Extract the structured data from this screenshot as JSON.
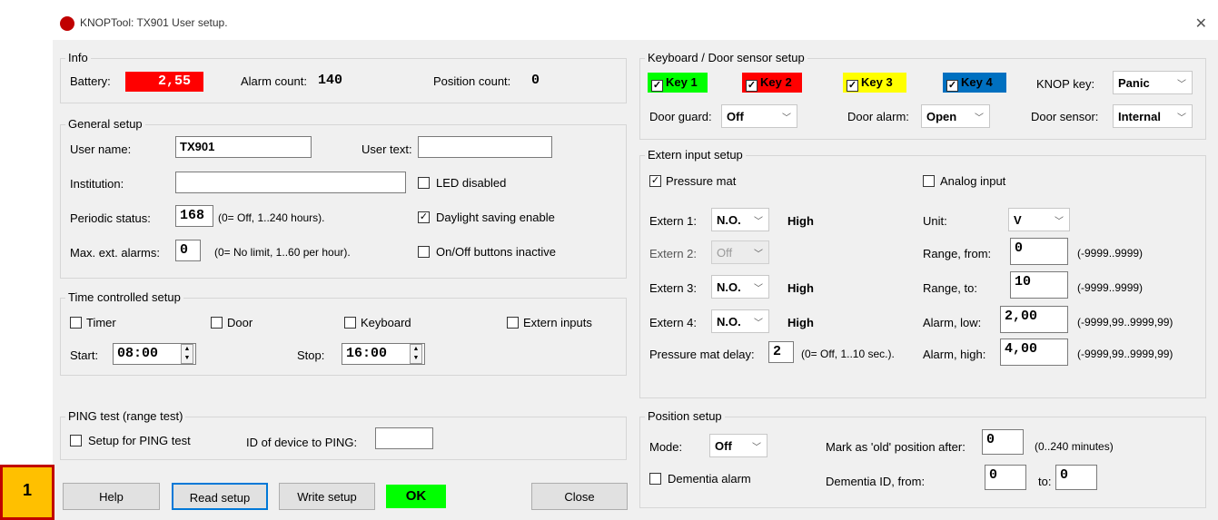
{
  "window": {
    "title": "KNOPTool: TX901 User setup.",
    "close_glyph": "✕"
  },
  "badge": {
    "number": "1"
  },
  "info": {
    "legend": "Info",
    "battery_label": "Battery:",
    "battery_value": "2,55",
    "alarm_count_label": "Alarm count:",
    "alarm_count_value": "140",
    "position_count_label": "Position count:",
    "position_count_value": "0"
  },
  "general": {
    "legend": "General setup",
    "user_name_label": "User name:",
    "user_name_value": "TX901",
    "user_text_label": "User text:",
    "user_text_value": "",
    "institution_label": "Institution:",
    "institution_value": "",
    "led_disabled_label": "LED disabled",
    "led_disabled_checked": false,
    "periodic_label": "Periodic status:",
    "periodic_value": "168",
    "periodic_hint": "(0= Off, 1..240 hours).",
    "daylight_label": "Daylight saving enable",
    "daylight_checked": true,
    "max_alarms_label": "Max. ext. alarms:",
    "max_alarms_value": "0",
    "max_alarms_hint": "(0= No limit, 1..60 per hour).",
    "onoff_label": "On/Off buttons inactive",
    "onoff_checked": false
  },
  "time": {
    "legend": "Time controlled setup",
    "timer_label": "Timer",
    "door_label": "Door",
    "keyboard_label": "Keyboard",
    "extern_label": "Extern inputs",
    "start_label": "Start:",
    "start_value": "08:00",
    "stop_label": "Stop:",
    "stop_value": "16:00"
  },
  "ping": {
    "legend": "PING test (range test)",
    "setup_label": "Setup for PING test",
    "id_label": "ID of device to PING:",
    "id_value": ""
  },
  "buttons": {
    "help": "Help",
    "read": "Read setup",
    "write": "Write setup",
    "status": "OK",
    "close": "Close"
  },
  "keyboard": {
    "legend": "Keyboard / Door sensor setup",
    "keys": [
      {
        "label": "Key 1",
        "color": "#00ff00",
        "checked": true
      },
      {
        "label": "Key 2",
        "color": "#ff0000",
        "checked": true
      },
      {
        "label": "Key 3",
        "color": "#ffff00",
        "checked": true
      },
      {
        "label": "Key 4",
        "color": "#0070c0",
        "checked": true
      }
    ],
    "knop_key_label": "KNOP key:",
    "knop_key_value": "Panic",
    "door_guard_label": "Door guard:",
    "door_guard_value": "Off",
    "door_alarm_label": "Door alarm:",
    "door_alarm_value": "Open",
    "door_sensor_label": "Door sensor:",
    "door_sensor_value": "Internal"
  },
  "extern": {
    "legend": "Extern input setup",
    "pressure_mat_label": "Pressure mat",
    "pressure_mat_checked": true,
    "analog_label": "Analog input",
    "analog_checked": false,
    "inputs": [
      {
        "label": "Extern 1:",
        "value": "N.O.",
        "level": "High",
        "enabled": true
      },
      {
        "label": "Extern 2:",
        "value": "Off",
        "level": "",
        "enabled": false
      },
      {
        "label": "Extern 3:",
        "value": "N.O.",
        "level": "High",
        "enabled": true
      },
      {
        "label": "Extern 4:",
        "value": "N.O.",
        "level": "High",
        "enabled": true
      }
    ],
    "unit_label": "Unit:",
    "unit_value": "V",
    "range_from_label": "Range, from:",
    "range_from_value": "0",
    "range_from_hint": "(-9999..9999)",
    "range_to_label": "Range, to:",
    "range_to_value": "10",
    "range_to_hint": "(-9999..9999)",
    "alarm_low_label": "Alarm, low:",
    "alarm_low_value": "2,00",
    "alarm_low_hint": "(-9999,99..9999,99)",
    "alarm_high_label": "Alarm, high:",
    "alarm_high_value": "4,00",
    "alarm_high_hint": "(-9999,99..9999,99)",
    "delay_label": "Pressure mat delay:",
    "delay_value": "2",
    "delay_hint": "(0= Off, 1..10 sec.)."
  },
  "position": {
    "legend": "Position setup",
    "mode_label": "Mode:",
    "mode_value": "Off",
    "mark_old_label": "Mark as 'old' position after:",
    "mark_old_value": "0",
    "mark_old_hint": "(0..240 minutes)",
    "dementia_label": "Dementia alarm",
    "dementia_id_label": "Dementia ID, from:",
    "dementia_from_value": "0",
    "dementia_to_label": "to:",
    "dementia_to_value": "0"
  }
}
